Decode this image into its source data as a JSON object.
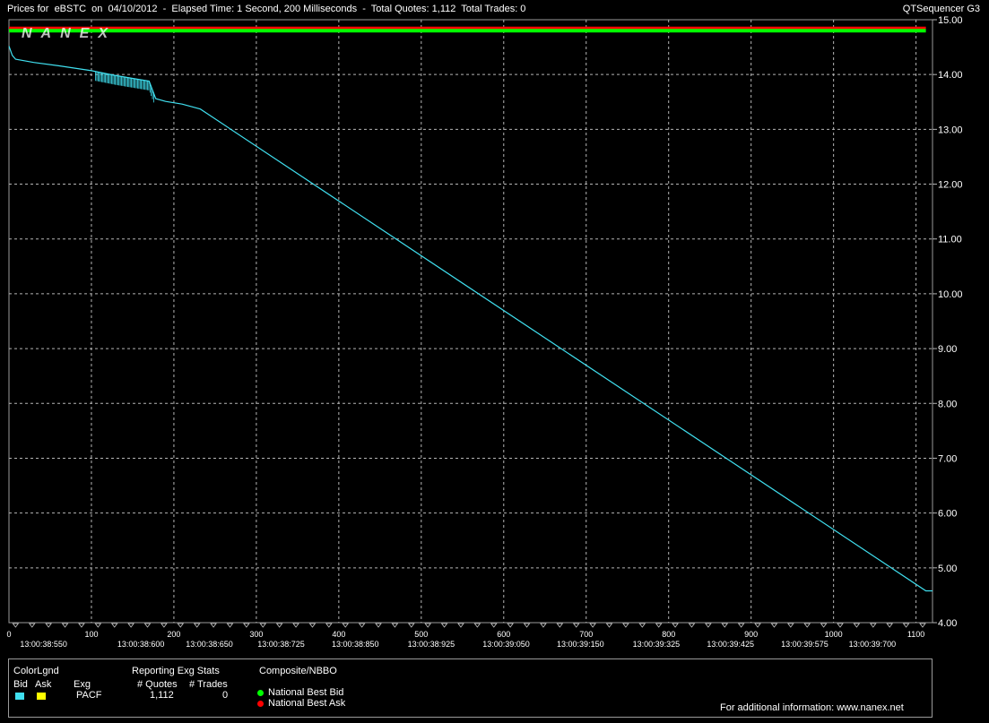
{
  "header": {
    "left_text": "Prices for  eBSTC  on  04/10/2012  -  Elapsed Time: 1 Second, 200 Milliseconds  -  Total Quotes: 1,112  Total Trades: 0",
    "right_text": "QTSequencer G3",
    "watermark": "NANEX"
  },
  "legend": {
    "colorlgnd_label": "ColorLgnd",
    "bid_label": "Bid",
    "ask_label": "Ask",
    "exg_label": "Exg",
    "exg_value": "PACF",
    "stats_title": "Reporting Exg Stats",
    "quotes_label": "# Quotes",
    "trades_label": "# Trades",
    "quotes_value": "1,112",
    "trades_value": "0",
    "composite_title": "Composite/NBBO",
    "nbb_label": "National Best Bid",
    "nba_label": "National Best Ask",
    "info_text": "For additional information: www.nanex.net",
    "colors": {
      "bid": "#40e0f0",
      "ask": "#ffff00",
      "nbb": "#00ff00",
      "nba": "#ff0000"
    }
  },
  "chart_data": {
    "type": "line",
    "xlim": [
      0,
      1120
    ],
    "ylim": [
      4.0,
      15.0
    ],
    "y_ticks": [
      "4.00",
      "5.00",
      "6.00",
      "7.00",
      "8.00",
      "9.00",
      "10.00",
      "11.00",
      "12.00",
      "13.00",
      "14.00",
      "15.00"
    ],
    "x_ticks": [
      "0",
      "100",
      "200",
      "300",
      "400",
      "500",
      "600",
      "700",
      "800",
      "900",
      "1000",
      "1100"
    ],
    "time_labels": [
      {
        "x": 42,
        "label": "13:00:38:550"
      },
      {
        "x": 160,
        "label": "13:00:38:600"
      },
      {
        "x": 243,
        "label": "13:00:38:650"
      },
      {
        "x": 330,
        "label": "13:00:38:725"
      },
      {
        "x": 420,
        "label": "13:00:38:850"
      },
      {
        "x": 512,
        "label": "13:00:38:925"
      },
      {
        "x": 603,
        "label": "13:00:39:050"
      },
      {
        "x": 693,
        "label": "13:00:39:150"
      },
      {
        "x": 785,
        "label": "13:00:39:325"
      },
      {
        "x": 875,
        "label": "13:00:39:425"
      },
      {
        "x": 965,
        "label": "13:00:39:575"
      },
      {
        "x": 1047,
        "label": "13:00:39:700"
      }
    ],
    "grid": true,
    "series": [
      {
        "name": "Bid",
        "color": "#40e0f0",
        "x": [
          0,
          4,
          8,
          30,
          60,
          100,
          130,
          150,
          170,
          178,
          190,
          210,
          232,
          1112,
          1120
        ],
        "y": [
          14.52,
          14.35,
          14.28,
          14.22,
          14.16,
          14.07,
          13.98,
          13.93,
          13.88,
          13.56,
          13.51,
          13.46,
          13.37,
          4.58,
          4.58
        ]
      },
      {
        "name": "National Best Ask",
        "color": "#ff0000",
        "x": [
          0,
          1112
        ],
        "y": [
          14.84,
          14.84
        ]
      },
      {
        "name": "National Best Bid",
        "color": "#00ff00",
        "x": [
          0,
          1112
        ],
        "y": [
          14.8,
          14.8
        ]
      }
    ]
  }
}
